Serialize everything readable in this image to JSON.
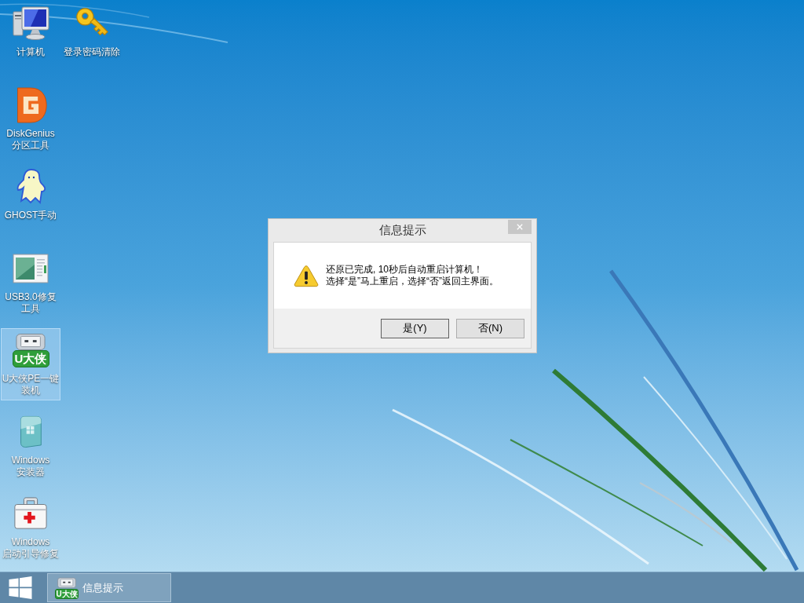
{
  "desktop": {
    "icon_columns": [
      [
        {
          "label_lines": [
            "计算机"
          ],
          "kind": "computer",
          "selected": false
        },
        {
          "label_lines": [
            "DiskGenius",
            "分区工具"
          ],
          "kind": "disk-tool",
          "selected": false
        },
        {
          "label_lines": [
            "GHOST手动"
          ],
          "kind": "ghost",
          "selected": false
        },
        {
          "label_lines": [
            "USB3.0修复",
            "工具"
          ],
          "kind": "app-window",
          "selected": false
        },
        {
          "label_lines": [
            "U大侠PE一键",
            "装机"
          ],
          "kind": "usb-drive",
          "icon_text": "U大侠",
          "selected": true
        },
        {
          "label_lines": [
            "Windows",
            "安装器"
          ],
          "kind": "installer",
          "selected": false
        },
        {
          "label_lines": [
            "Windows",
            "启动引导修复"
          ],
          "kind": "toolbox",
          "selected": false
        }
      ],
      [
        {
          "label_lines": [
            "登录密码清除"
          ],
          "kind": "key",
          "selected": false
        }
      ]
    ]
  },
  "dialog": {
    "title": "信息提示",
    "message_lines": [
      "还原已完成, 10秒后自动重启计算机！",
      "选择“是”马上重启，选择“否”返回主界面。"
    ],
    "buttons": [
      {
        "label": "是(Y)",
        "default": true
      },
      {
        "label": "否(N)",
        "default": false
      }
    ]
  },
  "taskbar": {
    "items": [
      {
        "label": "信息提示",
        "icon_text": "U大侠",
        "selected": true
      }
    ]
  }
}
